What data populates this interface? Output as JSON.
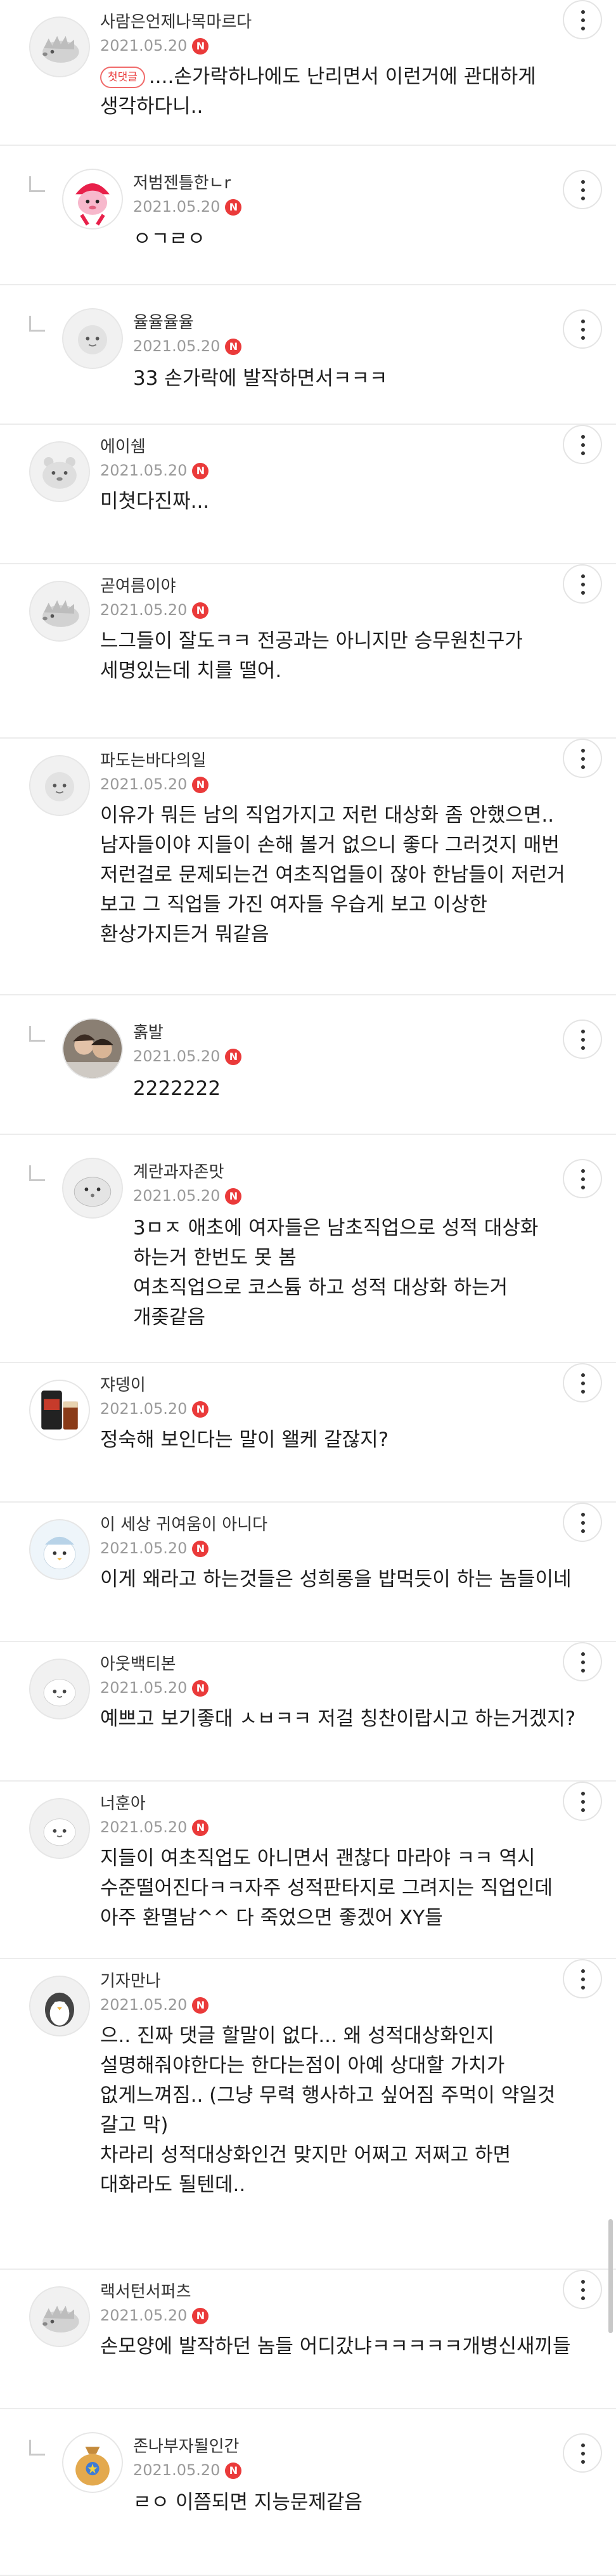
{
  "badge_text": "N",
  "first_comment_tag": "첫댓글",
  "comments": [
    {
      "nick": "사람은언제나목마르다",
      "date": "2021.05.20",
      "reply": false,
      "avatar": "hedgehog",
      "first": true,
      "lines": [
        "....손가락하나에도 난리면서 이런거에 관대하게",
        "생각하다니.."
      ]
    },
    {
      "nick": "저범젠틀한ㄴr",
      "date": "2021.05.20",
      "reply": true,
      "avatar": "pink-character",
      "lines": [
        "ㅇㄱㄹㅇ"
      ]
    },
    {
      "nick": "율율율율",
      "date": "2021.05.20",
      "reply": true,
      "avatar": "sheep",
      "lines": [
        "33 손가락에 발작하면서ㅋㅋㅋ"
      ]
    },
    {
      "nick": "에이쉠",
      "date": "2021.05.20",
      "reply": false,
      "avatar": "bear",
      "lines": [
        "미쳣다진짜..."
      ]
    },
    {
      "nick": "곧여름이야",
      "date": "2021.05.20",
      "reply": false,
      "avatar": "hedgehog",
      "lines": [
        "느그들이 잘도ㅋㅋ 전공과는 아니지만 승무원친구가",
        "세명있는데 치를 떨어."
      ]
    },
    {
      "nick": "파도는바다의일",
      "date": "2021.05.20",
      "reply": false,
      "avatar": "sheep",
      "lines": [
        "이유가 뭐든 남의 직업가지고 저런 대상화 좀 안했으면..",
        "남자들이야 지들이 손해 볼거 없으니 좋다 그러것지 매번",
        "저런걸로 문제되는건 여초직업들이 잖아 한남들이 저런거",
        "보고 그 직업들 가진 여자들 우습게 보고 이상한",
        "환상가지든거 뭐같음"
      ]
    },
    {
      "nick": "홁발",
      "date": "2021.05.20",
      "reply": true,
      "avatar": "photo",
      "lines": [
        "2222222"
      ]
    },
    {
      "nick": "계란과자존맛",
      "date": "2021.05.20",
      "reply": true,
      "avatar": "seal",
      "lines": [
        "3ㅁㅈ 애초에 여자들은 남초직업으로 성적 대상화",
        "하는거 한번도 못 봄",
        "여초직업으로 코스튬 하고 성적 대상화 하는거",
        "개좆같음"
      ]
    },
    {
      "nick": "쟈뎅이",
      "date": "2021.05.20",
      "reply": false,
      "avatar": "drink",
      "lines": [
        "정숙해 보인다는 말이 왤케 갈잖지?"
      ]
    },
    {
      "nick": "이 세상 귀여움이 아니다",
      "date": "2021.05.20",
      "reply": false,
      "avatar": "penguin",
      "lines": [
        "이게 왜라고 하는것들은 성희롱을 밥먹듯이 하는 놈들이네"
      ]
    },
    {
      "nick": "아웃백티본",
      "date": "2021.05.20",
      "reply": false,
      "avatar": "blob",
      "lines": [
        "예쁘고 보기좋대 ㅅㅂㅋㅋ 저걸 칭찬이랍시고 하는거겠지?"
      ]
    },
    {
      "nick": "너훈아",
      "date": "2021.05.20",
      "reply": false,
      "avatar": "blob",
      "lines": [
        "지들이 여초직업도 아니면서 괜찮다 마라야 ㅋㅋ 역시",
        "수준떨어진다ㅋㅋ자주 성적판타지로 그려지는 직업인데",
        "아주 환멸남^^ 다 죽었으면 좋겠어 XY들"
      ]
    },
    {
      "nick": "기자만나",
      "date": "2021.05.20",
      "reply": false,
      "avatar": "penguin-bw",
      "lines": [
        "으.. 진짜 댓글 할말이 없다... 왜 성적대상화인지",
        "설명해줘야한다는 한다는점이 아예 상대할 가치가",
        "없게느껴짐.. (그냥 무력 행사하고 싶어짐 주먹이 약일것",
        "갈고 막)",
        "차라리 성적대상화인건 맞지만 어쩌고 저쩌고 하면",
        "대화라도 될텐데.."
      ]
    },
    {
      "nick": "랙서턴서퍼츠",
      "date": "2021.05.20",
      "reply": false,
      "avatar": "hedgehog",
      "lines": [
        "손모양에 발작하던 놈들 어디갔냐ㅋㅋㅋㅋㅋ개병신새끼들"
      ]
    },
    {
      "nick": "존나부자될인간",
      "date": "2021.05.20",
      "reply": true,
      "avatar": "money-bag",
      "lines": [
        "ㄹㅇ 이쯤되면 지능문제같음"
      ]
    }
  ]
}
